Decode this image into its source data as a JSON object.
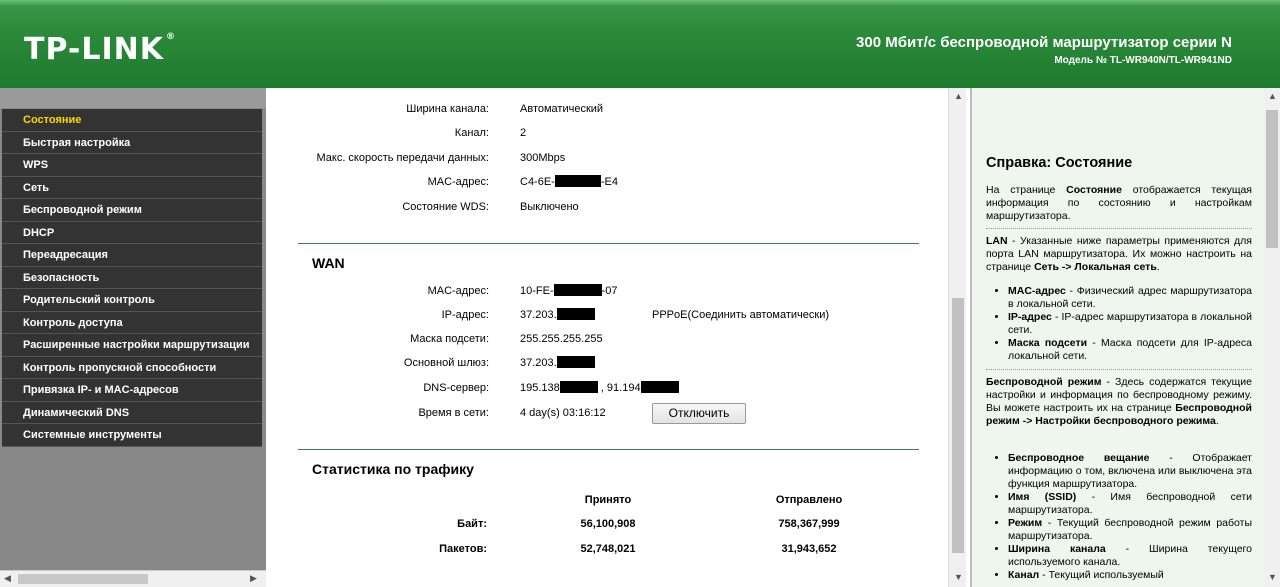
{
  "header": {
    "logo": "TP-LINK",
    "logo_reg": "®",
    "title": "300 Мбит/с беспроводной маршрутизатор серии N",
    "model": "Модель № TL-WR940N/TL-WR941ND"
  },
  "menu": [
    "Состояние",
    "Быстрая настройка",
    "WPS",
    "Сеть",
    "Беспроводной режим",
    "DHCP",
    "Переадресация",
    "Безопасность",
    "Родительский контроль",
    "Контроль доступа",
    "Расширенные настройки маршрутизации",
    "Контроль пропускной способности",
    "Привязка IP- и MAC-адресов",
    "Динамический DNS",
    "Системные инструменты"
  ],
  "wireless": {
    "channel_width_label": "Ширина канала:",
    "channel_width": "Автоматический",
    "channel_label": "Канал:",
    "channel": "2",
    "max_rate_label": "Макс. скорость передачи данных:",
    "max_rate": "300Mbps",
    "mac_label": "MAC-адрес:",
    "mac_prefix": "C4-6E-",
    "mac_suffix": "-E4",
    "wds_label": "Состояние WDS:",
    "wds": "Выключено"
  },
  "wan": {
    "title": "WAN",
    "mac_label": "MAC-адрес:",
    "mac_prefix": "10-FE-",
    "mac_suffix": "-07",
    "ip_label": "IP-адрес:",
    "ip_prefix": "37.203.",
    "connection_type": "PPPoE(Соединить автоматически)",
    "mask_label": "Маска подсети:",
    "mask": "255.255.255.255",
    "gateway_label": "Основной шлюз:",
    "gateway_prefix": "37.203.",
    "dns_label": "DNS-сервер:",
    "dns1_prefix": "195.138",
    "dns_sep": " , 91.194",
    "uptime_label": "Время в сети:",
    "uptime": "4 day(s) 03:16:12",
    "disconnect_button": "Отключить"
  },
  "traffic": {
    "title": "Статистика по трафику",
    "received_header": "Принято",
    "sent_header": "Отправлено",
    "bytes_label": "Байт:",
    "bytes_received": "56,100,908",
    "bytes_sent": "758,367,999",
    "packets_label": "Пакетов:",
    "packets_received": "52,748,021",
    "packets_sent": "31,943,652"
  },
  "help": {
    "title": "Справка: Состояние",
    "p1_a": "На странице ",
    "p1_b": "Состояние",
    "p1_c": " отображается текущая информация по состоянию и настройкам маршрутизатора.",
    "p2_a": "LAN",
    "p2_b": " - Указанные ниже параметры применяются для порта LAN маршрутизатора. Их можно настроить на странице ",
    "p2_c": "Сеть -> Локальная сеть",
    "p2_d": ".",
    "lan_items": [
      {
        "term": "MAC-адрес",
        "desc": " - Физический адрес маршрутизатора в локальной сети."
      },
      {
        "term": "IP-адрес",
        "desc": " - IP-адрес маршрутизатора в локальной сети."
      },
      {
        "term": "Маска подсети",
        "desc": " - Маска подсети для IP-адреса локальной сети."
      }
    ],
    "p3_a": "Беспроводной режим",
    "p3_b": " - Здесь содержатся текущие настройки и информация по беспроводному режиму. Вы можете настроить их на странице ",
    "p3_c": "Беспроводной режим -> Настройки беспроводного режима",
    "p3_d": ".",
    "wl_items": [
      {
        "term": "Беспроводное вещание",
        "desc": " - Отображает информацию о том, включена или выключена эта функция маршрутизатора."
      },
      {
        "term": "Имя (SSID)",
        "desc": " - Имя беспроводной сети маршрутизатора."
      },
      {
        "term": "Режим",
        "desc": " - Текущий беспроводной режим работы маршрутизатора."
      },
      {
        "term": "Ширина канала",
        "desc": " - Ширина текущего используемого канала."
      },
      {
        "term": "Канал",
        "desc": " - Текущий используемый"
      }
    ]
  }
}
